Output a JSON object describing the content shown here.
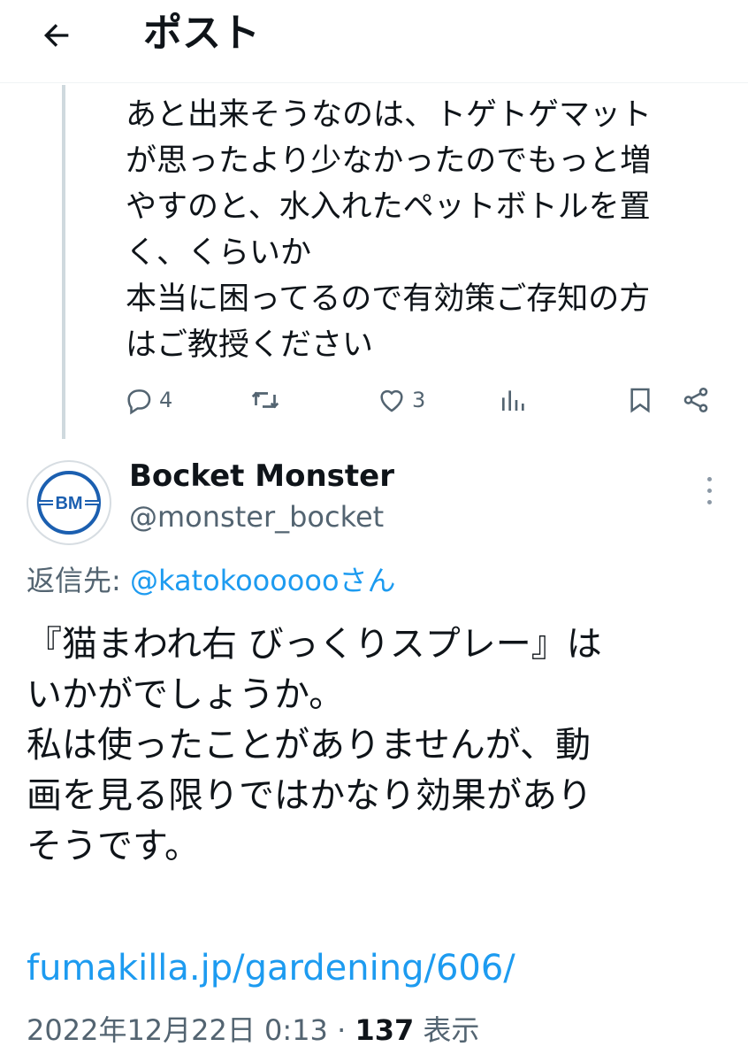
{
  "header": {
    "title": "ポスト"
  },
  "parent_post": {
    "text": "あと出来そうなのは、トゲトゲマット\nが思ったより少なかったのでもっと増\nやすのと、水入れたペットボトルを置\nく、くらいか\n本当に困ってるので有効策ご存知の方\nはご教授ください",
    "actions": {
      "reply_count": "4",
      "retweet_count": "",
      "like_count": "3"
    }
  },
  "reply_post": {
    "display_name": "Bocket Monster",
    "handle": "@monster_bocket",
    "avatar_text": "BM",
    "reply_to_label": "返信先: ",
    "reply_to_link": "@katokoooooo",
    "reply_to_suffix": "さん",
    "text": "『猫まわれ右 びっくりスプレー』は\nいかがでしょうか。\n私は使ったことがありませんが、動\n画を見る限りではかなり効果があり\nそうです。",
    "link": "fumakilla.jp/gardening/606/",
    "timestamp": "2022年12月22日 0:13",
    "separator": " · ",
    "views_count": "137",
    "views_label": " 表示"
  },
  "colors": {
    "accent": "#1d9bf0",
    "secondary_text": "#536471",
    "primary_text": "#0f1419",
    "avatar_blue": "#1b5fb0"
  },
  "icons": {
    "back": "arrow-left-icon",
    "reply": "speech-bubble-icon",
    "retweet": "retweet-icon",
    "like": "heart-icon",
    "views": "bar-chart-icon",
    "bookmark": "bookmark-icon",
    "share": "share-icon",
    "more": "more-vertical-icon"
  }
}
